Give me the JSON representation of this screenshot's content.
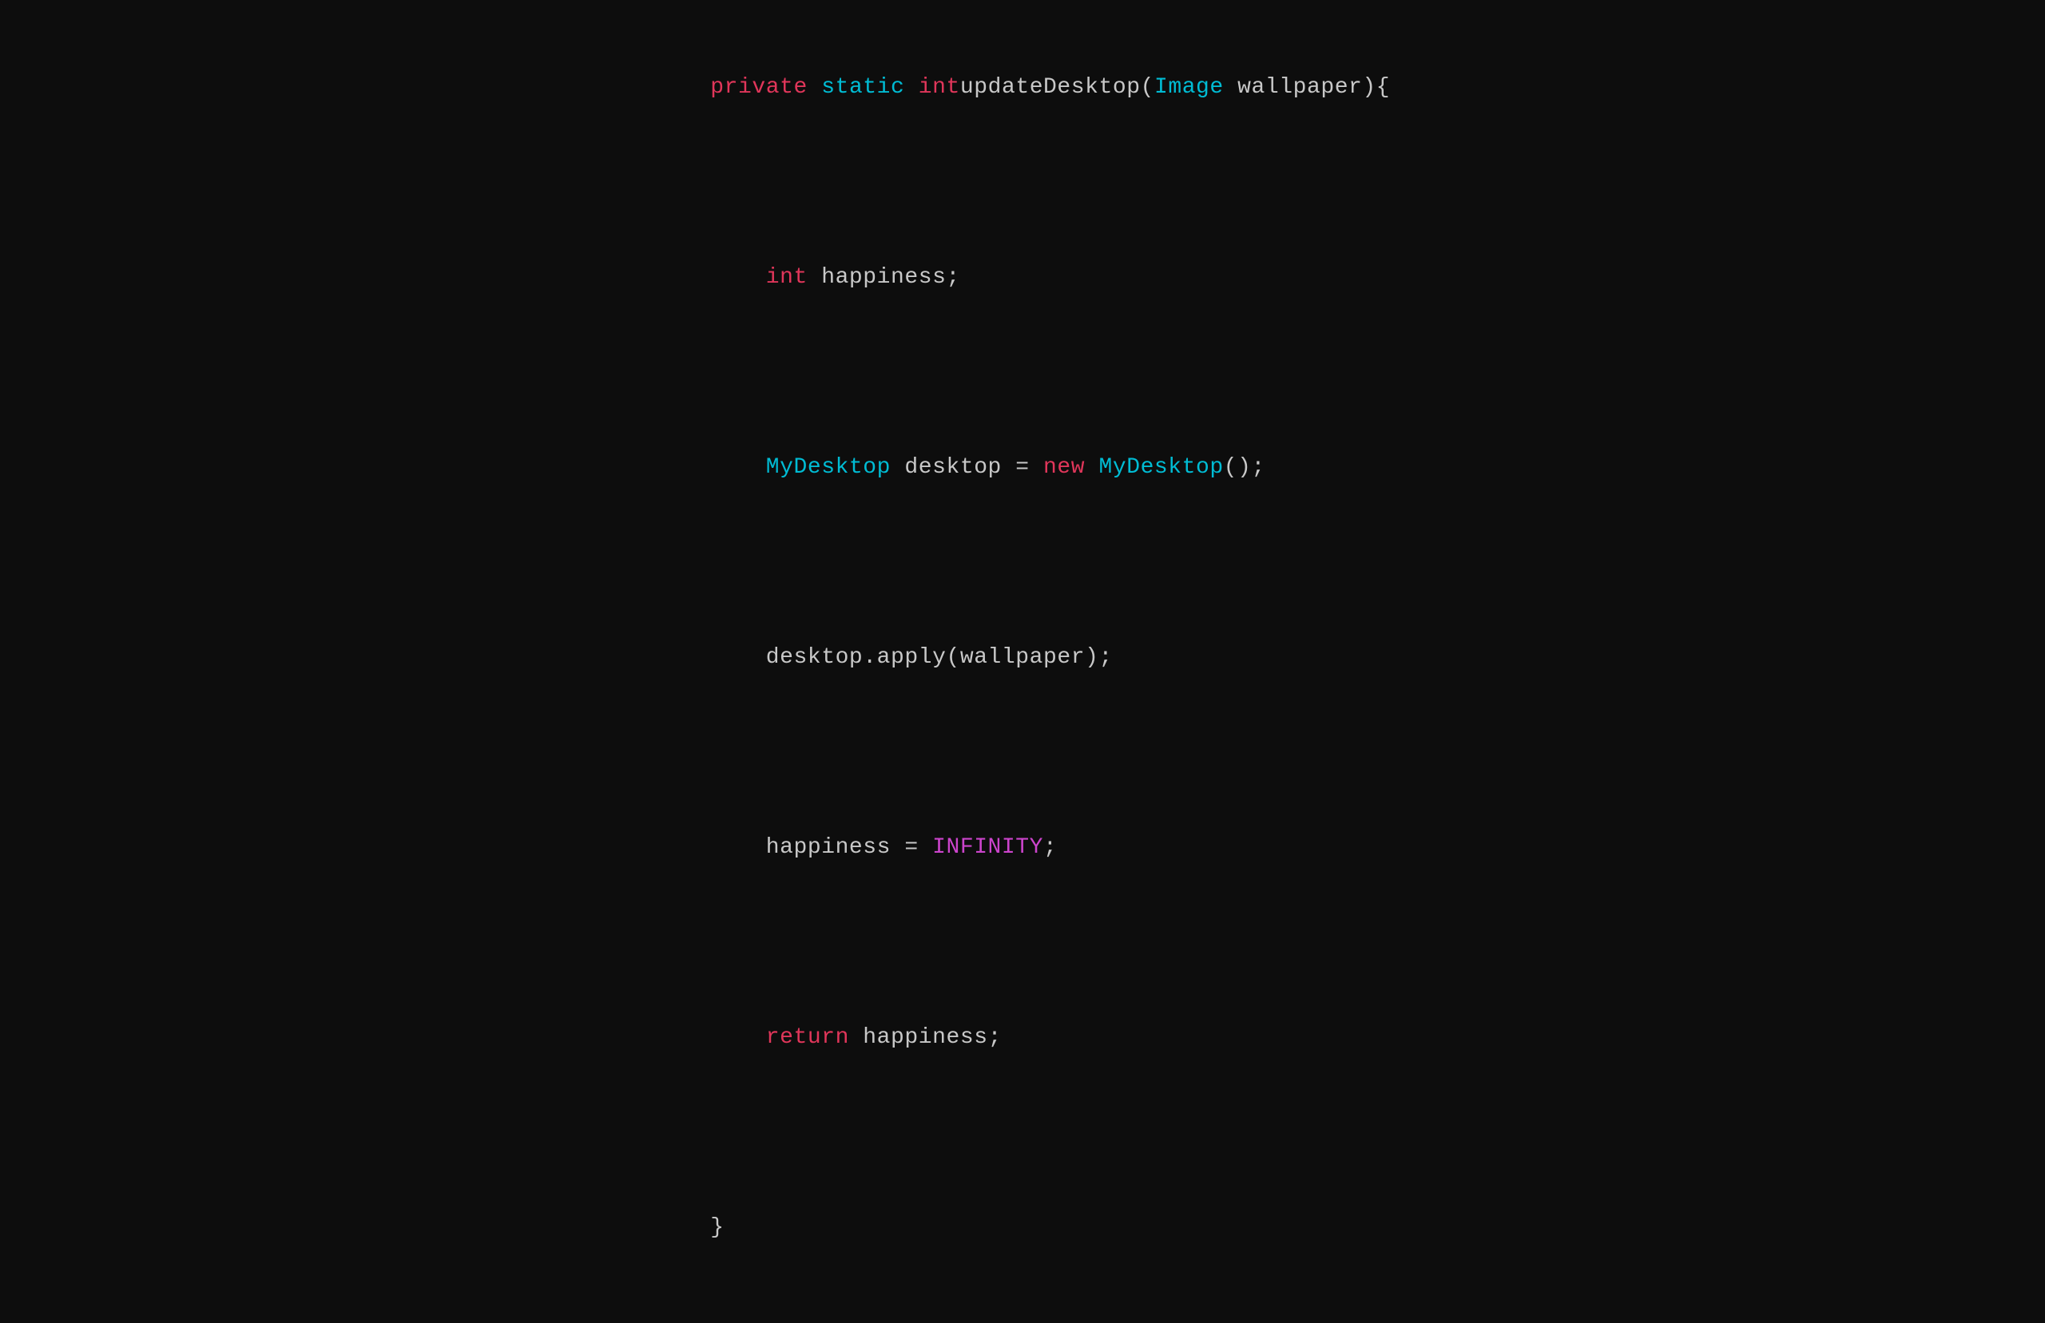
{
  "code": {
    "line1": {
      "keyword_private": "private",
      "space1": " ",
      "keyword_static": "static",
      "space2": " ",
      "keyword_int": "int",
      "space3": " ",
      "plain_method": "updateDesktop(",
      "type_image": "Image",
      "plain_param": " wallpaper){"
    },
    "line2": {
      "indent": "    ",
      "keyword_int": "int",
      "plain": " happiness;"
    },
    "line3": {
      "indent": "    ",
      "type_mydesktop": "MyDesktop",
      "plain": " desktop = ",
      "keyword_new": "new",
      "space": " ",
      "type_mydesktop2": "MyDesktop",
      "plain2": "();"
    },
    "line4": {
      "indent": "    ",
      "plain": "desktop.apply(wallpaper);"
    },
    "line5": {
      "indent": "    ",
      "plain_var": "happiness = ",
      "constant": "INFINITY",
      "plain_semi": ";"
    },
    "line6": {
      "indent": "    ",
      "keyword_return": "return",
      "plain": " happiness;"
    },
    "line7": {
      "plain": "}"
    }
  }
}
